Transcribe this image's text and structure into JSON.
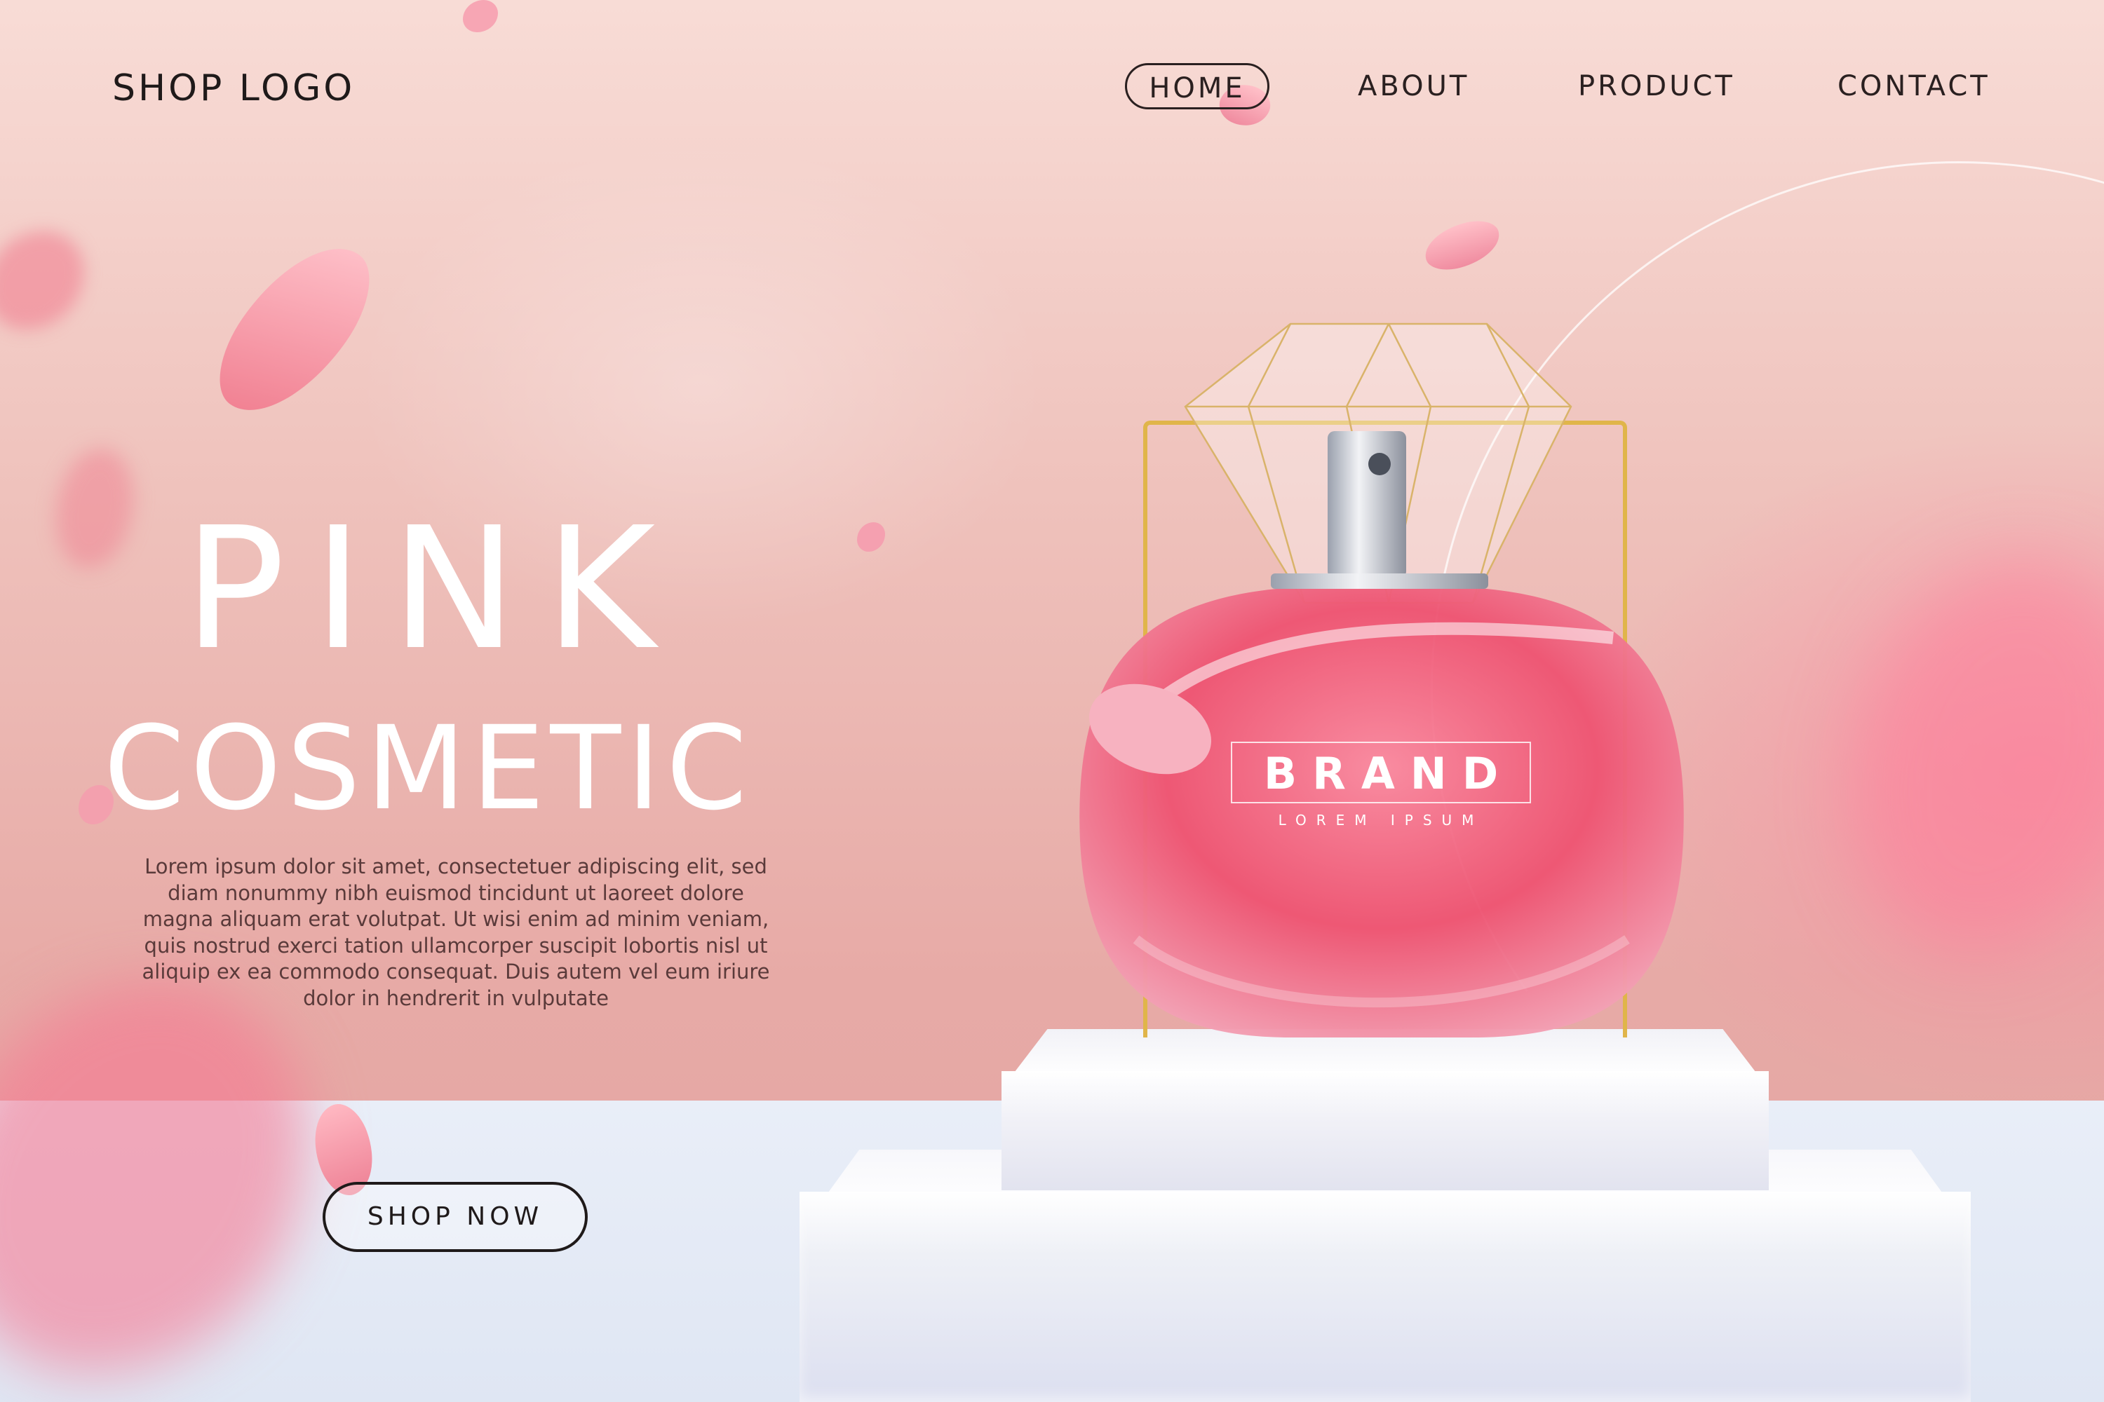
{
  "header": {
    "logo": "SHOP LOGO",
    "nav": [
      {
        "label": "HOME",
        "active": true
      },
      {
        "label": "ABOUT",
        "active": false
      },
      {
        "label": "PRODUCT",
        "active": false
      },
      {
        "label": "CONTACT",
        "active": false
      }
    ]
  },
  "hero": {
    "title_line1": "PINK",
    "title_line2": "COSMETIC",
    "body": "Lorem ipsum dolor sit amet, consectetuer adipiscing elit, sed diam nonummy nibh euismod tincidunt ut laoreet dolore magna aliquam erat volutpat. Ut wisi enim ad minim veniam, quis nostrud exerci tation ullamcorper suscipit lobortis nisl ut aliquip ex ea commodo consequat. Duis autem vel eum iriure dolor in hendrerit in vulputate",
    "cta_label": "SHOP NOW"
  },
  "product": {
    "brand": "BRAND",
    "subtitle": "LOREM IPSUM"
  },
  "colors": {
    "accent_pink": "#e8506e",
    "gold": "#e0b54a",
    "text_dark": "#1f1a1a"
  }
}
